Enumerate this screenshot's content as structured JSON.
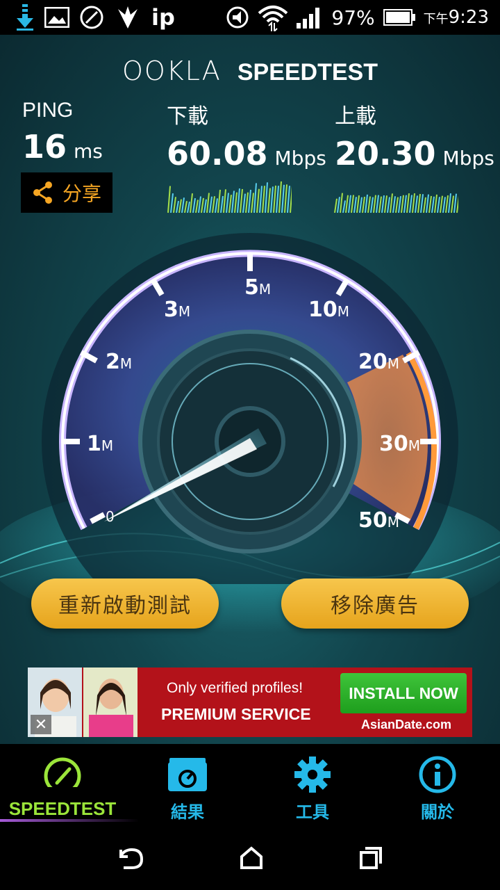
{
  "status_bar": {
    "carrier_label": "ip",
    "battery": "97%",
    "time_prefix": "下午",
    "time": "9:23"
  },
  "header": {
    "brand_ookla": "OOKLA",
    "brand_speedtest": "SPEEDTEST"
  },
  "results": {
    "ping": {
      "label": "PING",
      "value": "16",
      "unit": "ms"
    },
    "download": {
      "label": "下載",
      "value": "60.08",
      "unit": "Mbps"
    },
    "upload": {
      "label": "上載",
      "value": "20.30",
      "unit": "Mbps"
    },
    "share_label": "分享"
  },
  "gauge": {
    "ticks": [
      {
        "num": "0",
        "unit": ""
      },
      {
        "num": "1",
        "unit": "M"
      },
      {
        "num": "2",
        "unit": "M"
      },
      {
        "num": "3",
        "unit": "M"
      },
      {
        "num": "5",
        "unit": "M"
      },
      {
        "num": "10",
        "unit": "M"
      },
      {
        "num": "20",
        "unit": "M"
      },
      {
        "num": "30",
        "unit": "M"
      },
      {
        "num": "50",
        "unit": "M"
      }
    ]
  },
  "actions": {
    "restart_label": "重新啟動測試",
    "remove_ads_label": "移除廣告"
  },
  "ad": {
    "tagline": "Only verified profiles!",
    "headline": "PREMIUM SERVICE",
    "cta": "INSTALL NOW",
    "domain": "AsianDate.com",
    "close_glyph": "✕"
  },
  "tabs": [
    {
      "label": "SPEEDTEST",
      "icon": "gauge-icon",
      "active": true
    },
    {
      "label": "結果",
      "icon": "folder-gauge-icon",
      "active": false
    },
    {
      "label": "工具",
      "icon": "gear-icon",
      "active": false
    },
    {
      "label": "關於",
      "icon": "info-icon",
      "active": false
    }
  ],
  "colors": {
    "accent_orange": "#f6a623",
    "tab_blue": "#25b9e9",
    "tab_active_green": "#9be53a",
    "gauge_purple": "#9d7be0",
    "ad_red": "#b3121a"
  }
}
